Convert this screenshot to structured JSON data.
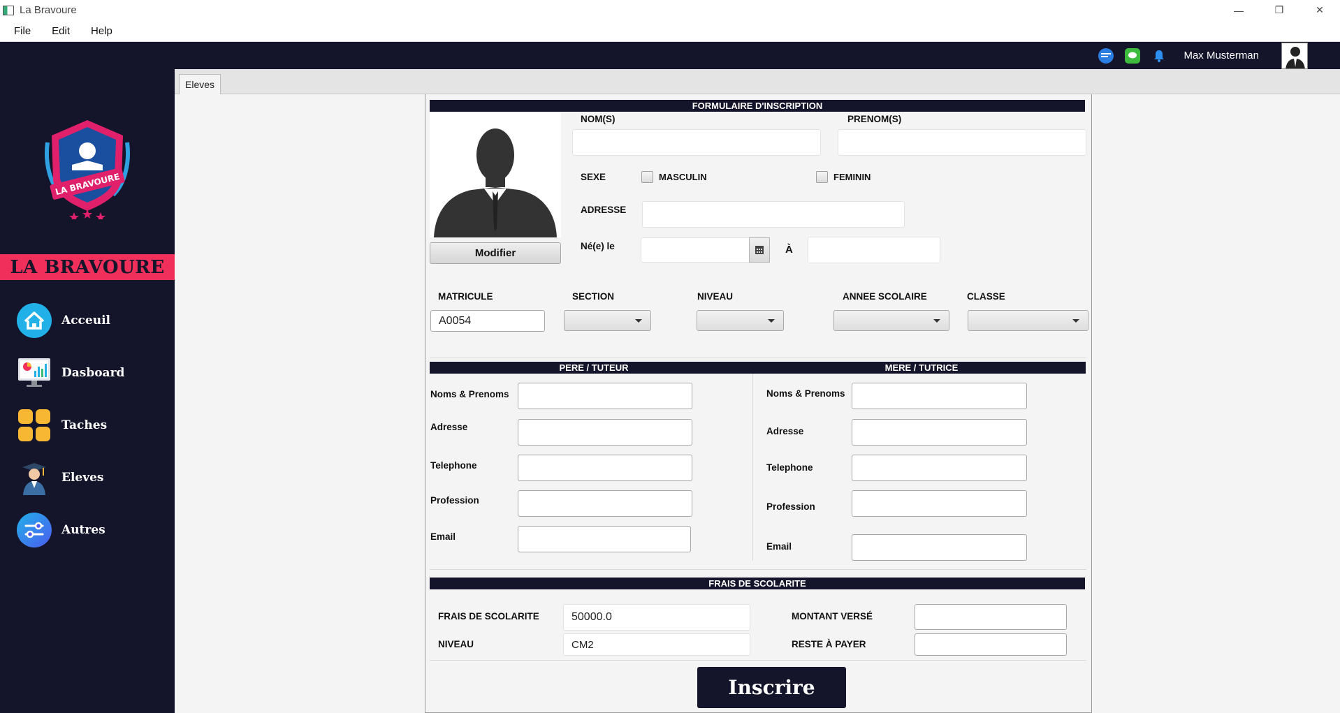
{
  "window": {
    "title": "La Bravoure",
    "minimize": "—",
    "restore": "❐",
    "close": "✕"
  },
  "menu": [
    "File",
    "Edit",
    "Help"
  ],
  "header": {
    "user_name": "Max Musterman"
  },
  "sidebar": {
    "brand": "LA BRAVOURE",
    "logo_text": "LA BRAVOURE",
    "items": [
      {
        "label": "Acceuil",
        "icon": "home-icon"
      },
      {
        "label": "Dasboard",
        "icon": "dashboard-icon"
      },
      {
        "label": "Taches",
        "icon": "tasks-icon"
      },
      {
        "label": "Eleves",
        "icon": "student-icon"
      },
      {
        "label": "Autres",
        "icon": "settings-icon"
      }
    ]
  },
  "tabs": [
    {
      "label": "Eleves",
      "active": true
    }
  ],
  "form": {
    "title": "FORMULAIRE D'INSCRIPTION",
    "modify_label": "Modifier",
    "nom_label": "NOM(S)",
    "prenom_label": "PRENOM(S)",
    "sexe_label": "SEXE",
    "masculin_label": "MASCULIN",
    "feminin_label": "FEMININ",
    "adresse_label": "ADRESSE",
    "ne_le_label": "Né(e) le",
    "a_label": "À",
    "matricule_label": "MATRICULE",
    "matricule_value": "A0054",
    "section_label": "SECTION",
    "niveau_label": "NIVEAU",
    "annee_label": "ANNEE SCOLAIRE",
    "classe_label": "CLASSE",
    "pere_title": "PERE / TUTEUR",
    "mere_title": "MERE / TUTRICE",
    "parent_fields": {
      "noms": "Noms & Prenoms",
      "adresse": "Adresse",
      "telephone": "Telephone",
      "profession": "Profession",
      "email": "Email"
    },
    "frais_title": "FRAIS DE SCOLARITE",
    "frais_label": "FRAIS DE SCOLARITE",
    "frais_value": "50000.0",
    "niveau2_label": "NIVEAU",
    "niveau2_value": "CM2",
    "montant_label": "MONTANT VERSÉ",
    "reste_label": "RESTE À PAYER",
    "submit_label": "Inscrire"
  },
  "colors": {
    "dark": "#14142a",
    "accent": "#f0305a"
  }
}
